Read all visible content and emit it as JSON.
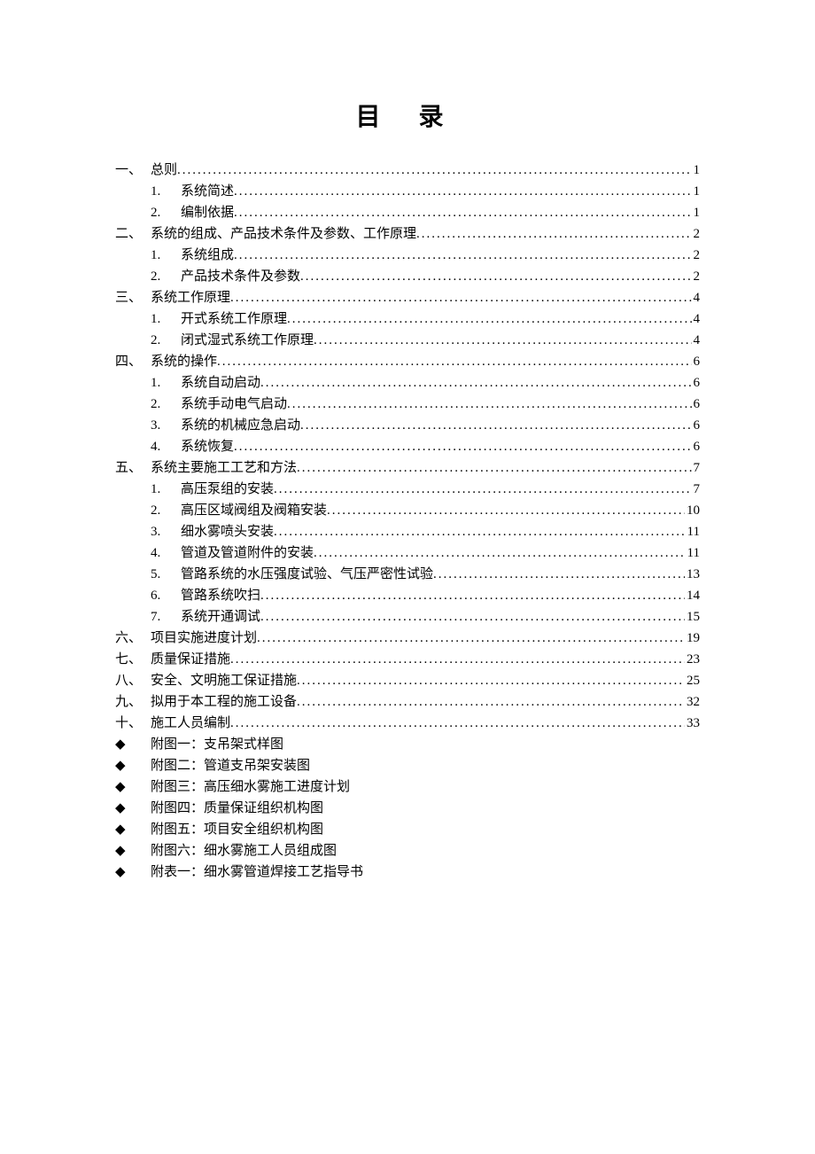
{
  "title": "目 录",
  "toc": [
    {
      "level": 1,
      "marker": "一、",
      "label": "总则",
      "page": "1"
    },
    {
      "level": 2,
      "marker": "1.",
      "label": "系统简述",
      "page": "1"
    },
    {
      "level": 2,
      "marker": "2.",
      "label": "编制依据",
      "page": "1"
    },
    {
      "level": 1,
      "marker": "二、",
      "label": "系统的组成、产品技术条件及参数、工作原理",
      "page": "2"
    },
    {
      "level": 2,
      "marker": "1.",
      "label": "系统组成",
      "page": "2"
    },
    {
      "level": 2,
      "marker": "2.",
      "label": "产品技术条件及参数",
      "page": "2"
    },
    {
      "level": 1,
      "marker": "三、",
      "label": "系统工作原理",
      "page": "4"
    },
    {
      "level": 2,
      "marker": "1.",
      "label": "开式系统工作原理",
      "page": "4"
    },
    {
      "level": 2,
      "marker": "2.",
      "label": "闭式湿式系统工作原理",
      "page": "4"
    },
    {
      "level": 1,
      "marker": "四、",
      "label": "系统的操作",
      "page": "6"
    },
    {
      "level": 2,
      "marker": "1.",
      "label": "系统自动启动",
      "page": "6"
    },
    {
      "level": 2,
      "marker": "2.",
      "label": "系统手动电气启动",
      "page": "6"
    },
    {
      "level": 2,
      "marker": "3.",
      "label": "系统的机械应急启动",
      "page": "6"
    },
    {
      "level": 2,
      "marker": "4.",
      "label": "系统恢复",
      "page": "6"
    },
    {
      "level": 1,
      "marker": "五、",
      "label": "系统主要施工工艺和方法",
      "page": "7"
    },
    {
      "level": 2,
      "marker": "1.",
      "label": "高压泵组的安装",
      "page": "7"
    },
    {
      "level": 2,
      "marker": "2.",
      "label": "高压区域阀组及阀箱安装",
      "page": "10"
    },
    {
      "level": 2,
      "marker": "3.",
      "label": "细水雾喷头安装",
      "page": "11"
    },
    {
      "level": 2,
      "marker": "4.",
      "label": "管道及管道附件的安装",
      "page": "11"
    },
    {
      "level": 2,
      "marker": "5.",
      "label": "管路系统的水压强度试验、气压严密性试验",
      "page": "13"
    },
    {
      "level": 2,
      "marker": "6.",
      "label": "管路系统吹扫",
      "page": "14"
    },
    {
      "level": 2,
      "marker": "7.",
      "label": "系统开通调试",
      "page": "15"
    },
    {
      "level": 1,
      "marker": "六、",
      "label": "项目实施进度计划",
      "page": "19"
    },
    {
      "level": 1,
      "marker": "七、",
      "label": "质量保证措施",
      "page": "23"
    },
    {
      "level": 1,
      "marker": "八、",
      "label": "安全、文明施工保证措施",
      "page": "25"
    },
    {
      "level": 1,
      "marker": "九、",
      "label": "拟用于本工程的施工设备",
      "page": "32"
    },
    {
      "level": 1,
      "marker": "十、",
      "label": "施工人员编制",
      "page": "33"
    }
  ],
  "attachments": [
    "附图一：支吊架式样图",
    "附图二：管道支吊架安装图",
    "附图三：高压细水雾施工进度计划",
    "附图四：质量保证组织机构图",
    "附图五：项目安全组织机构图",
    "附图六：细水雾施工人员组成图",
    "附表一：细水雾管道焊接工艺指导书"
  ],
  "bullet": "◆"
}
